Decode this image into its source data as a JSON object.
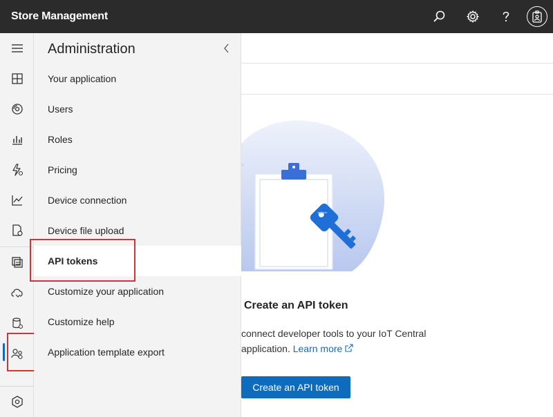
{
  "header": {
    "app_title": "Store Management",
    "icons": [
      "search-icon",
      "settings-icon",
      "help-icon",
      "account-icon"
    ]
  },
  "rail": {
    "items": [
      "menu-icon",
      "dashboard-icon",
      "devices-icon",
      "device-groups-icon",
      "rules-icon",
      "analytics-icon",
      "jobs-icon",
      "device-templates-icon",
      "data-export-icon",
      "data-explorer-icon",
      "administration-icon",
      "iot-central-icon"
    ]
  },
  "panel": {
    "title": "Administration",
    "items": [
      {
        "label": "Your application"
      },
      {
        "label": "Users"
      },
      {
        "label": "Roles"
      },
      {
        "label": "Pricing"
      },
      {
        "label": "Device connection"
      },
      {
        "label": "Device file upload"
      },
      {
        "label": "API tokens"
      },
      {
        "label": "Customize your application"
      },
      {
        "label": "Customize help"
      },
      {
        "label": "Application template export"
      }
    ],
    "selected": "API tokens"
  },
  "content": {
    "empty_heading": "Create an API token",
    "empty_desc": "connect developer tools to your IoT Central application.",
    "learn_more": "Learn more",
    "cta_label": "Create an API token"
  },
  "colors": {
    "topbar": "#2b2b2b",
    "accent": "#0f6cbd",
    "highlight": "#d13438"
  }
}
